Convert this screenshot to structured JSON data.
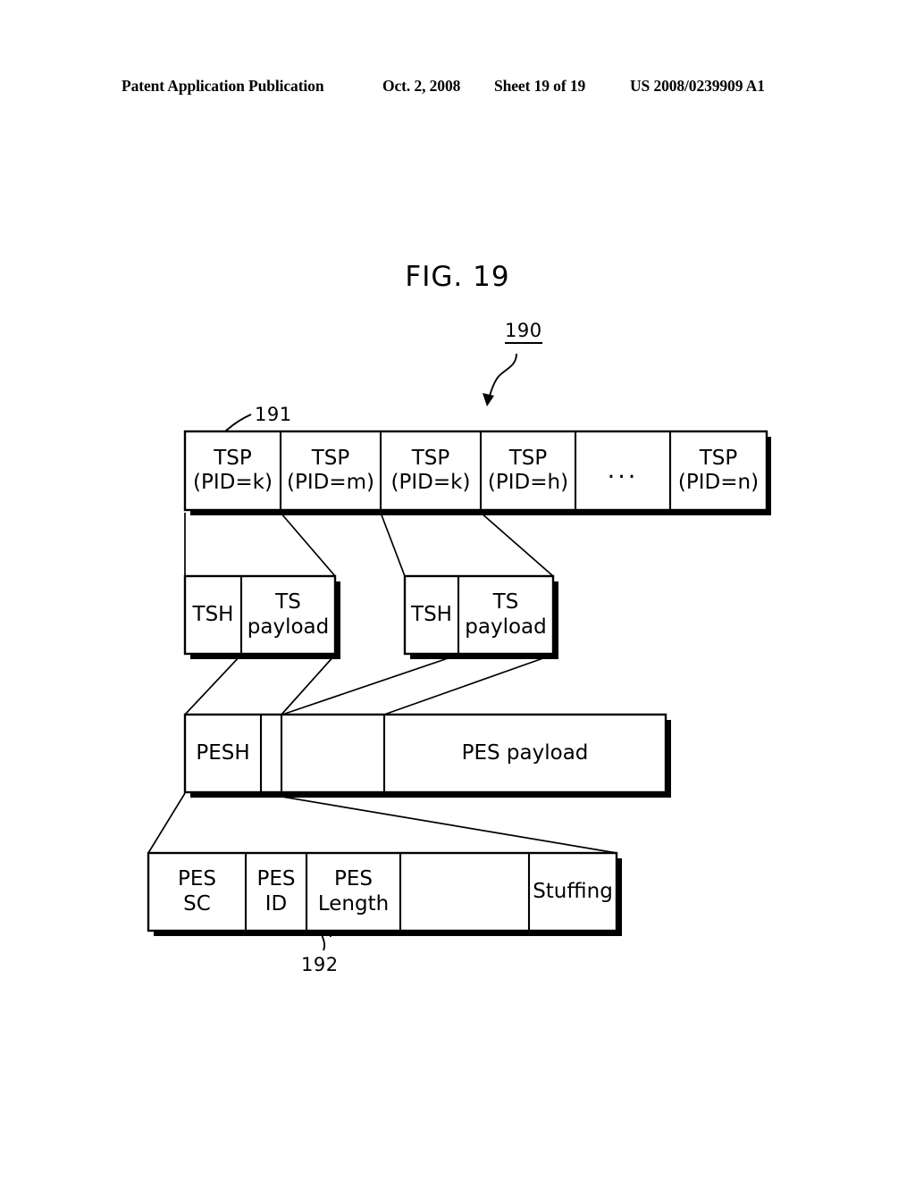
{
  "header": {
    "publication": "Patent Application Publication",
    "date": "Oct. 2, 2008",
    "sheet": "Sheet 19 of 19",
    "patent_number": "US 2008/0239909 A1"
  },
  "figure": {
    "title": "FIG. 19",
    "refs": {
      "diagram": "190",
      "tsp_stream": "191",
      "pes_header_detail": "192"
    }
  },
  "rows": {
    "tsp_row": {
      "cells": [
        {
          "line1": "TSP",
          "line2": "(PID=k)"
        },
        {
          "line1": "TSP",
          "line2": "(PID=m)"
        },
        {
          "line1": "TSP",
          "line2": "(PID=k)"
        },
        {
          "line1": "TSP",
          "line2": "(PID=h)"
        },
        {
          "line1": "...",
          "line2": ""
        },
        {
          "line1": "TSP",
          "line2": "(PID=n)"
        }
      ]
    },
    "ts_packet_row": {
      "packets": [
        {
          "header": {
            "line1": "TSH",
            "line2": ""
          },
          "payload": {
            "line1": "TS",
            "line2": "payload"
          }
        },
        {
          "header": {
            "line1": "TSH",
            "line2": ""
          },
          "payload": {
            "line1": "TS",
            "line2": "payload"
          }
        }
      ]
    },
    "pes_row": {
      "cells": [
        {
          "line1": "PESH",
          "line2": ""
        },
        {
          "line1": "",
          "line2": ""
        },
        {
          "line1": "",
          "line2": ""
        },
        {
          "line1": "PES payload",
          "line2": ""
        }
      ]
    },
    "pes_header_row": {
      "cells": [
        {
          "line1": "PES",
          "line2": "SC"
        },
        {
          "line1": "PES",
          "line2": "ID"
        },
        {
          "line1": "PES",
          "line2": "Length"
        },
        {
          "line1": "",
          "line2": ""
        },
        {
          "line1": "Stuffing",
          "line2": ""
        }
      ]
    }
  },
  "colors": {
    "ink": "#000000",
    "paper": "#ffffff"
  }
}
